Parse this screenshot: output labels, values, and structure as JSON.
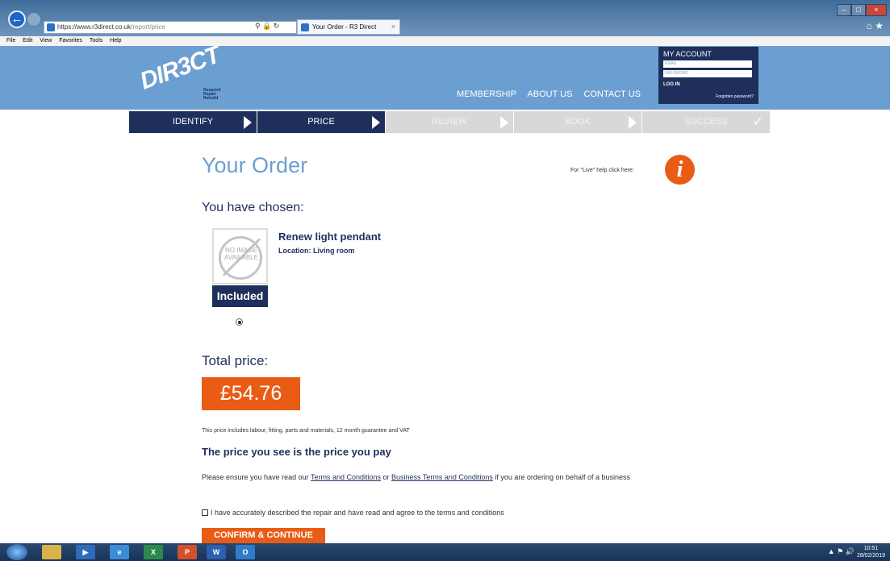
{
  "browser": {
    "url_host": "https://www.r3direct.co.uk",
    "url_path": "/report/price",
    "tab_title": "Your Order - R3 Direct",
    "menus": [
      "File",
      "Edit",
      "View",
      "Favorites",
      "Tools",
      "Help"
    ]
  },
  "site": {
    "logo_text": "DIR3CT",
    "logo_sub": [
      "Respond",
      "Repair",
      "Rebuild"
    ],
    "nav": [
      "MEMBERSHIP",
      "ABOUT US",
      "CONTACT US"
    ],
    "account": {
      "heading": "MY ACCOUNT",
      "email_placeholder": "EMAIL",
      "password_placeholder": "PASSWORD",
      "login": "LOG IN",
      "forgot": "Forgotten password?"
    },
    "steps": [
      "IDENTIFY",
      "PRICE",
      "REVIEW",
      "BOOK",
      "SUCCESS"
    ]
  },
  "order": {
    "title": "Your Order",
    "live_help": "For \"Live\" help click here:",
    "chosen_heading": "You have chosen:",
    "no_image": "NO IMAGE AVAILABLE",
    "included": "Included",
    "item_name": "Renew light pendant",
    "item_location": "Location: Living room",
    "total_heading": "Total price:",
    "price": "£54.76",
    "price_note": "This price includes labour, fitting, parts and materials, 12 month guarantee and VAT",
    "pay_title": "The price you see is the price you pay",
    "terms_pre": "Please ensure you have read our ",
    "terms_link": "Terms and Conditions",
    "terms_mid": " or ",
    "business_link": "Business Terms and Conditions",
    "terms_post": " if you are ordering on behalf of a business",
    "agree": "I have accurately described the repair and have read and agree to the terms and conditions",
    "confirm": "CONFIRM & CONTINUE"
  },
  "taskbar": {
    "time": "10:51",
    "date": "28/02/2019"
  },
  "colors": {
    "header": "#6c9fd1",
    "navy": "#1e2f5c",
    "orange": "#e85c16"
  }
}
